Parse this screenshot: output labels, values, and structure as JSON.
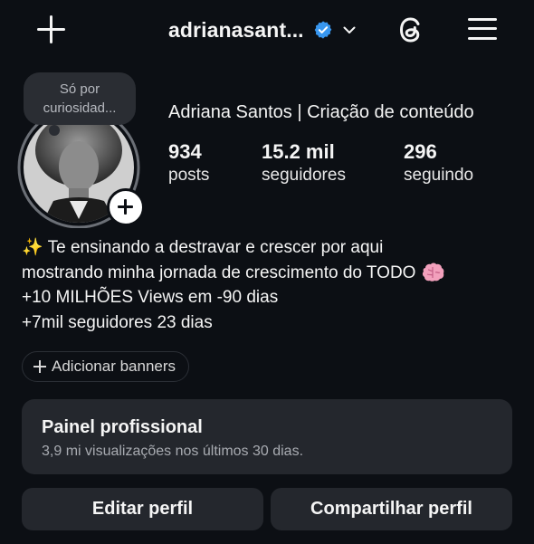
{
  "header": {
    "username": "adrianasant...",
    "icons": [
      "plus-icon",
      "verified-badge-icon",
      "chevron-down-icon",
      "threads-icon",
      "hamburger-menu-icon"
    ]
  },
  "note": {
    "text_line1": "Só por",
    "text_line2": "curiosidad..."
  },
  "profile": {
    "display_name": "Adriana Santos | Criação de conteúdo",
    "stats": [
      {
        "value": "934",
        "label": "posts"
      },
      {
        "value": "15.2 mil",
        "label": "seguidores"
      },
      {
        "value": "296",
        "label": "seguindo"
      }
    ]
  },
  "bio": {
    "line1": "✨ Te ensinando a destravar e crescer por aqui",
    "line2": "mostrando minha jornada de crescimento do TODO",
    "line3": "+10 MILHÕES Views em -90 dias",
    "line4": "+7mil seguidores 23 dias"
  },
  "banners": {
    "label": "Adicionar banners"
  },
  "dashboard": {
    "title": "Painel profissional",
    "subtitle": "3,9 mi visualizações nos últimos 30 dias."
  },
  "actions": {
    "edit_label": "Editar perfil",
    "share_label": "Compartilhar perfil"
  },
  "colors": {
    "background": "#0c0f14",
    "card": "#24272d",
    "verified": "#3897f0",
    "text": "#f5f5f5"
  }
}
